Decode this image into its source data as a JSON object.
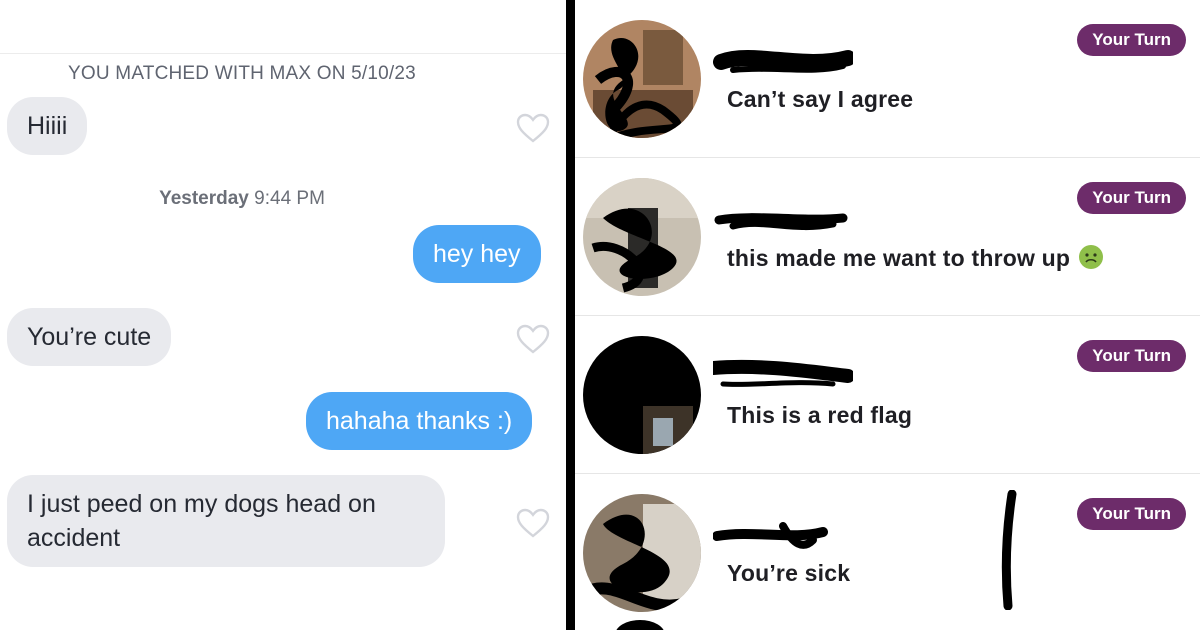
{
  "chat": {
    "match_banner": "YOU MATCHED WITH MAX ON 5/10/23",
    "timestamp_day": "Yesterday",
    "timestamp_time": "9:44 PM",
    "messages": [
      {
        "text": "Hiiii",
        "from": "them"
      },
      {
        "text": "hey hey",
        "from": "me"
      },
      {
        "text": "You’re cute",
        "from": "them"
      },
      {
        "text": "hahaha thanks :)",
        "from": "me"
      },
      {
        "text": "I just  peed on my dogs head on accident",
        "from": "them"
      }
    ],
    "colors": {
      "incoming": "#e9eaee",
      "outgoing": "#4ea7f5"
    }
  },
  "inbox": {
    "badge_color": "#6d2c6a",
    "conversations": [
      {
        "preview": "Can’t say I agree",
        "badge": "Your Turn"
      },
      {
        "preview": "this made me want to throw up",
        "badge": "Your Turn",
        "emoji": "nauseated-face-icon"
      },
      {
        "preview": "This is a red flag",
        "badge": "Your Turn"
      },
      {
        "preview": "You’re sick",
        "badge": "Your Turn"
      }
    ]
  }
}
